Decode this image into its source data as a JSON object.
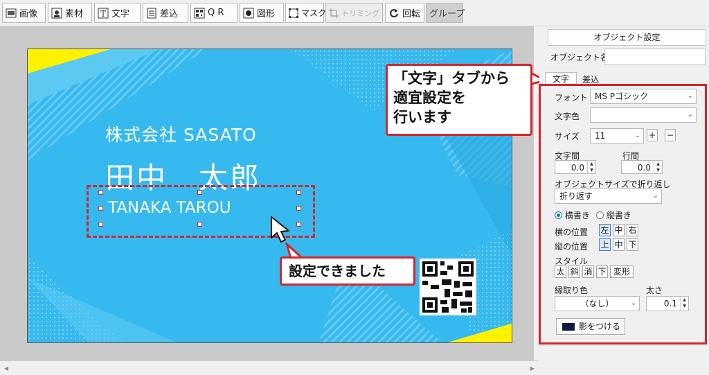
{
  "toolbar": {
    "items": [
      {
        "label": "画像",
        "icon": "image-icon"
      },
      {
        "label": "素材",
        "icon": "material-icon"
      },
      {
        "label": "文字",
        "icon": "text-icon"
      },
      {
        "label": "差込",
        "icon": "insert-icon"
      },
      {
        "label": "Q R",
        "icon": "qr-icon"
      },
      {
        "label": "図形",
        "icon": "shape-icon"
      },
      {
        "label": "マスク",
        "icon": "mask-icon"
      },
      {
        "label": "トリミング",
        "icon": "crop-icon",
        "disabled": true
      },
      {
        "label": "回転",
        "icon": "rotate-icon"
      },
      {
        "label": "グループ",
        "icon": ""
      }
    ]
  },
  "card": {
    "company": "株式会社 SASATO",
    "name": "田中　太郎",
    "romaji": "TANAKA TAROU",
    "colors": {
      "background": "#35b9ee",
      "accent": "#fff200"
    }
  },
  "callouts": {
    "tab_hint": [
      "「文字」タブから",
      "適宜設定を",
      "行います"
    ],
    "done": "設定できました"
  },
  "panel": {
    "title": "オブジェクト設定",
    "object_name_label": "オブジェクト名",
    "object_name_value": "",
    "tabs": {
      "text": "文字",
      "insert": "差込"
    },
    "font_label": "フォント",
    "font_value": "MS Pゴシック",
    "color_label": "文字色",
    "color_value": "",
    "size_label": "サイズ",
    "size_value": "11",
    "plus": "+",
    "minus": "−",
    "char_spacing_label": "文字間",
    "char_spacing_value": "0.0",
    "line_spacing_label": "行間",
    "line_spacing_value": "0.0",
    "wrap_label": "オブジェクトサイズで折り返し",
    "wrap_value": "折り返す",
    "horizontal": "横書き",
    "vertical": "縦書き",
    "hpos_label": "横の位置",
    "hpos": [
      "左",
      "中",
      "右"
    ],
    "vpos_label": "縦の位置",
    "vpos": [
      "上",
      "中",
      "下"
    ],
    "style_label": "スタイル",
    "styles": [
      "太",
      "斜",
      "消",
      "下",
      "変形"
    ],
    "outline_label": "縁取り色",
    "outline_value": "（なし）",
    "thickness_label": "太さ",
    "thickness_value": "0.1",
    "shadow_button": "影をつける"
  }
}
